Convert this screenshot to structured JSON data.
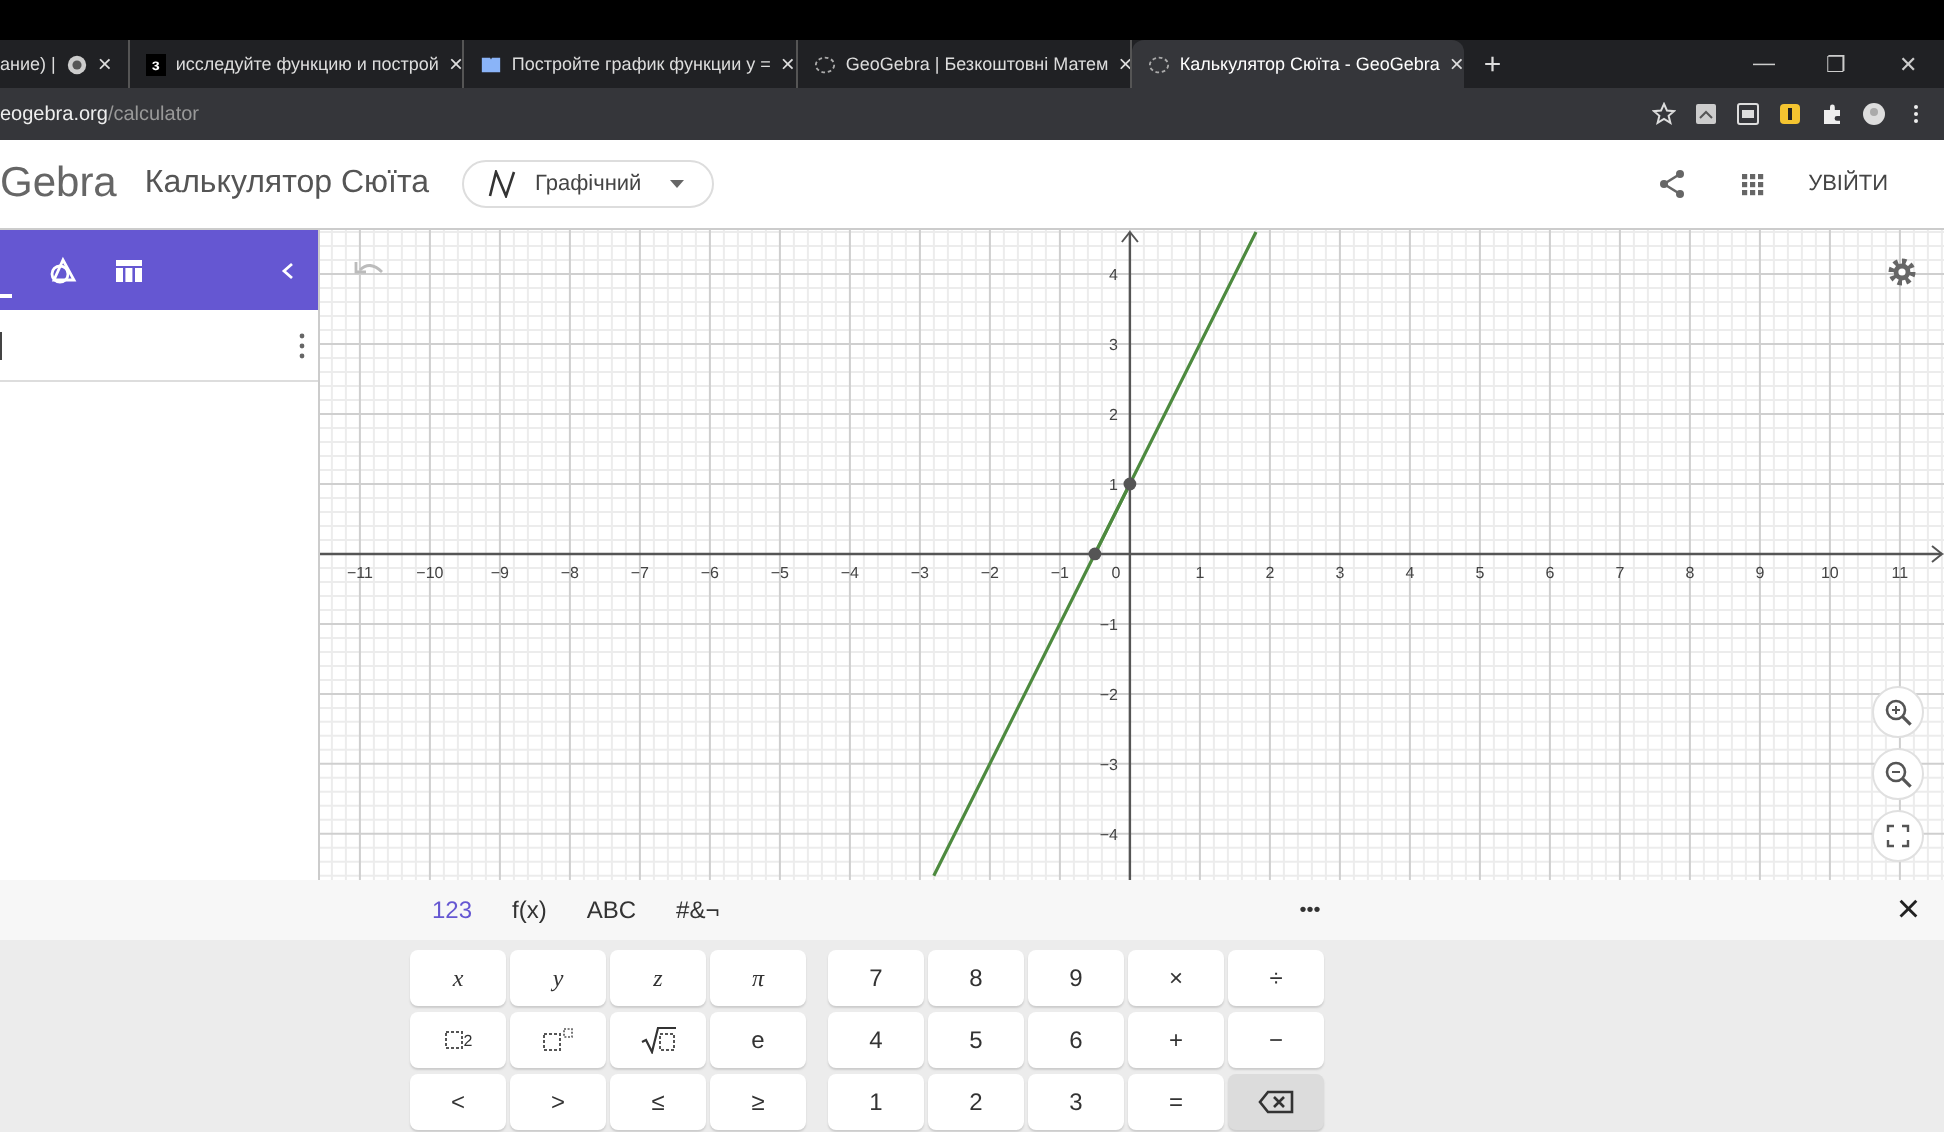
{
  "browser": {
    "tabs": [
      {
        "title": "ание) |",
        "selected": false,
        "kind": "favicon-ball"
      },
      {
        "title": "исследуйте функцию и построй",
        "selected": false,
        "kind": "favicon-letter",
        "badge": "з"
      },
      {
        "title": "Постройте график функции у =",
        "selected": false,
        "kind": "favicon-book"
      },
      {
        "title": "GeoGebra | Безкоштовні Матем",
        "selected": false,
        "kind": "favicon-geogebra"
      },
      {
        "title": "Калькулятор Сюїта - GeoGebra",
        "selected": true,
        "kind": "favicon-geogebra"
      }
    ],
    "close_label": "×",
    "new_tab": "+",
    "window_controls": [
      "—",
      "❐",
      "✕"
    ],
    "address": {
      "host": "eogebra.org",
      "path": "/calculator"
    }
  },
  "header": {
    "logo": "Gebra",
    "app_title": "Калькулятор Сюїта",
    "mode": "Графічний",
    "sign_in": "УВІЙТИ"
  },
  "graph": {
    "chart_data": {
      "type": "line",
      "x": [
        -2.8,
        -0.5,
        0,
        1.8
      ],
      "series": [
        {
          "color": "#4d8a3f",
          "values": [
            -4.6,
            0,
            1,
            4.6
          ]
        },
        {
          "color": "#4d8a3f",
          "marker": true,
          "values": [
            null,
            0,
            1,
            null
          ]
        }
      ],
      "xlim": [
        -11.57,
        11.63
      ],
      "ylim": [
        -4.66,
        4.63
      ],
      "xticks": [
        -11,
        -10,
        -9,
        -8,
        -7,
        -6,
        -5,
        -4,
        -3,
        -2,
        -1,
        1,
        2,
        3,
        4,
        5,
        6,
        7,
        8,
        9,
        10,
        11
      ],
      "yticks": [
        -4,
        -3,
        -2,
        -1,
        1,
        2,
        3,
        4
      ],
      "grid": true
    },
    "origin_label": "0"
  },
  "keyboard": {
    "tabs": [
      {
        "label": "123",
        "selected": true
      },
      {
        "label": "f(x)",
        "selected": false
      },
      {
        "label": "ABC",
        "selected": false
      },
      {
        "label": "#&¬",
        "selected": false
      }
    ],
    "more": "•••",
    "close": "×",
    "left_keys": [
      [
        {
          "kind": "var",
          "label": "x"
        },
        {
          "kind": "var",
          "label": "y"
        },
        {
          "kind": "var",
          "label": "z"
        },
        {
          "kind": "var",
          "label": "π"
        }
      ],
      [
        {
          "kind": "square",
          "label": "2"
        },
        {
          "kind": "power"
        },
        {
          "kind": "sqrt"
        },
        {
          "kind": "text",
          "label": "e"
        }
      ],
      [
        {
          "kind": "text",
          "label": "<"
        },
        {
          "kind": "text",
          "label": ">"
        },
        {
          "kind": "text",
          "label": "≤"
        },
        {
          "kind": "text",
          "label": "≥"
        }
      ]
    ],
    "right_keys": [
      [
        {
          "kind": "text",
          "label": "7"
        },
        {
          "kind": "text",
          "label": "8"
        },
        {
          "kind": "text",
          "label": "9"
        },
        {
          "kind": "text",
          "label": "×"
        },
        {
          "kind": "text",
          "label": "÷"
        }
      ],
      [
        {
          "kind": "text",
          "label": "4"
        },
        {
          "kind": "text",
          "label": "5"
        },
        {
          "kind": "text",
          "label": "6"
        },
        {
          "kind": "text",
          "label": "+"
        },
        {
          "kind": "text",
          "label": "−"
        }
      ],
      [
        {
          "kind": "text",
          "label": "1"
        },
        {
          "kind": "text",
          "label": "2"
        },
        {
          "kind": "text",
          "label": "3"
        },
        {
          "kind": "text",
          "label": "="
        },
        {
          "kind": "backspace"
        }
      ]
    ]
  }
}
